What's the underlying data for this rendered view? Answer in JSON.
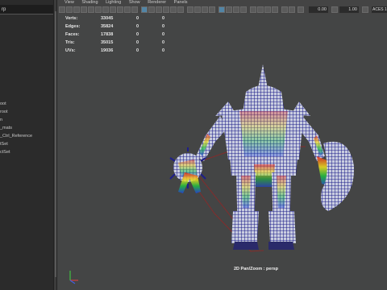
{
  "outliner": {
    "search_value": "rp",
    "items": [
      "oot",
      "root",
      "n",
      "_mats",
      "_Ctrl_Reference",
      "tSet",
      "ctSet"
    ]
  },
  "menu": [
    "View",
    "Shading",
    "Lighting",
    "Show",
    "Renderer",
    "Panels"
  ],
  "toolbar": {
    "field_1": "0.00",
    "field_2": "1.00",
    "color_space": "ACES 1.0 S"
  },
  "hud": {
    "rows": [
      {
        "label": "Verts:",
        "v1": "33045",
        "v2": "0",
        "v3": "0"
      },
      {
        "label": "Edges:",
        "v1": "35824",
        "v2": "0",
        "v3": "0"
      },
      {
        "label": "Faces:",
        "v1": "17838",
        "v2": "0",
        "v3": "0"
      },
      {
        "label": "Tris:",
        "v1": "35015",
        "v2": "0",
        "v3": "0"
      },
      {
        "label": "UVs:",
        "v1": "19036",
        "v2": "0",
        "v3": "0"
      }
    ]
  },
  "camera_label": "2D Pan/Zoom : persp",
  "colors": {
    "wire": "#1a1a8c",
    "viewport_bg": "#444545",
    "accent": "#5285a6"
  }
}
